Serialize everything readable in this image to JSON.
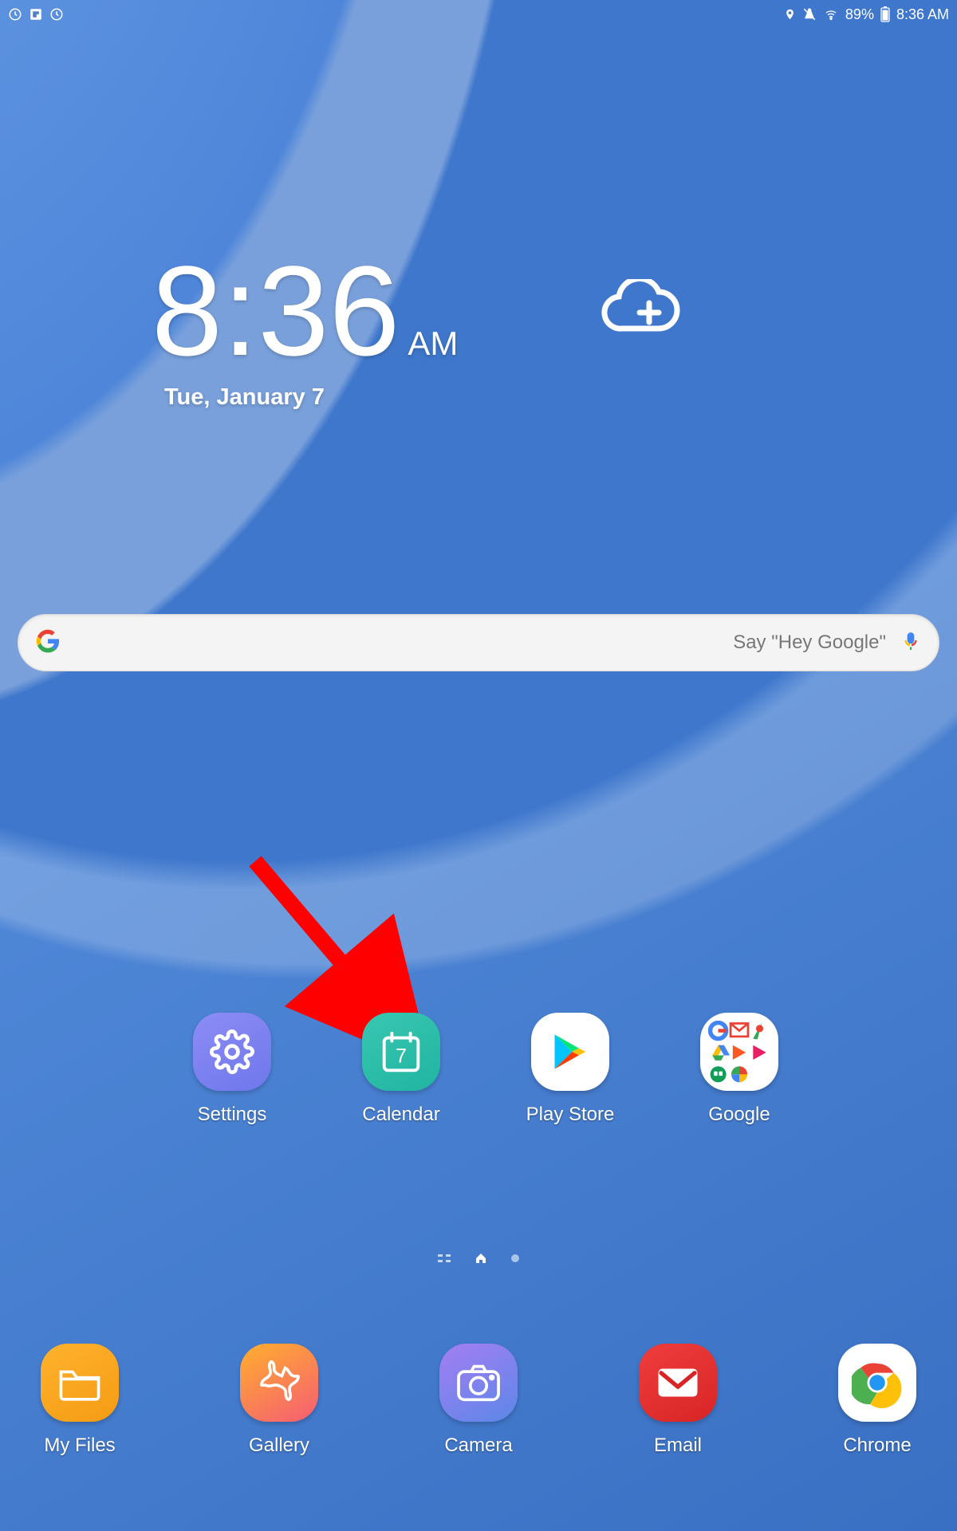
{
  "status": {
    "battery_pct": "89%",
    "time": "8:36 AM"
  },
  "clock": {
    "time": "8:36",
    "ampm": "AM",
    "date": "Tue, January 7"
  },
  "search": {
    "hint": "Say \"Hey Google\""
  },
  "apps_row": [
    {
      "label": "Settings"
    },
    {
      "label": "Calendar",
      "day": "7"
    },
    {
      "label": "Play Store"
    },
    {
      "label": "Google"
    }
  ],
  "dock": [
    {
      "label": "My Files"
    },
    {
      "label": "Gallery"
    },
    {
      "label": "Camera"
    },
    {
      "label": "Email"
    },
    {
      "label": "Chrome"
    }
  ],
  "annotation": {
    "points_to": "Settings"
  }
}
